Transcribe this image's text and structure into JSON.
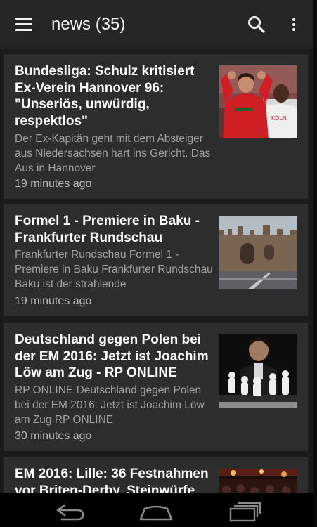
{
  "app_bar": {
    "title": "news (35)",
    "menu_icon": "hamburger-menu-icon",
    "search_icon": "search-icon",
    "more_icon": "more-vertical-icon"
  },
  "articles": [
    {
      "title": "Bundesliga: Schulz kritisiert Ex-Verein Hannover 96: \"Unseriös, unwürdig, respektlos\"",
      "snippet": "Der Ex-Kapitän geht mit dem Absteiger aus Niedersachsen hart ins Gericht. Das Aus in Hannover",
      "time": "19 minutes ago",
      "thumbnail": "football-player-photo"
    },
    {
      "title": "Formel 1 - Premiere in Baku - Frankfurter Rundschau",
      "snippet": "Frankfurter Rundschau Formel 1 - Premiere in Baku Frankfurter Rundschau Baku ist der strahlende",
      "time": "19 minutes ago",
      "thumbnail": "baku-old-city-wall-photo"
    },
    {
      "title": "Deutschland gegen Polen bei der EM 2016: Jetzt ist Joachim Löw am Zug - RP ONLINE",
      "snippet": "RP ONLINE Deutschland gegen Polen bei der EM 2016: Jetzt ist Joachim Löw am Zug RP ONLINE",
      "time": "30 minutes ago",
      "thumbnail": "chess-pieces-photo"
    },
    {
      "title": "EM 2016: Lille: 36 Festnahmen vor Briten-Derby, Steinwürfe",
      "snippet": "",
      "time": "",
      "thumbnail": "crowd-night-photo"
    }
  ],
  "nav_bar": {
    "back_icon": "back-icon",
    "home_icon": "home-icon",
    "recents_icon": "recent-apps-icon"
  }
}
